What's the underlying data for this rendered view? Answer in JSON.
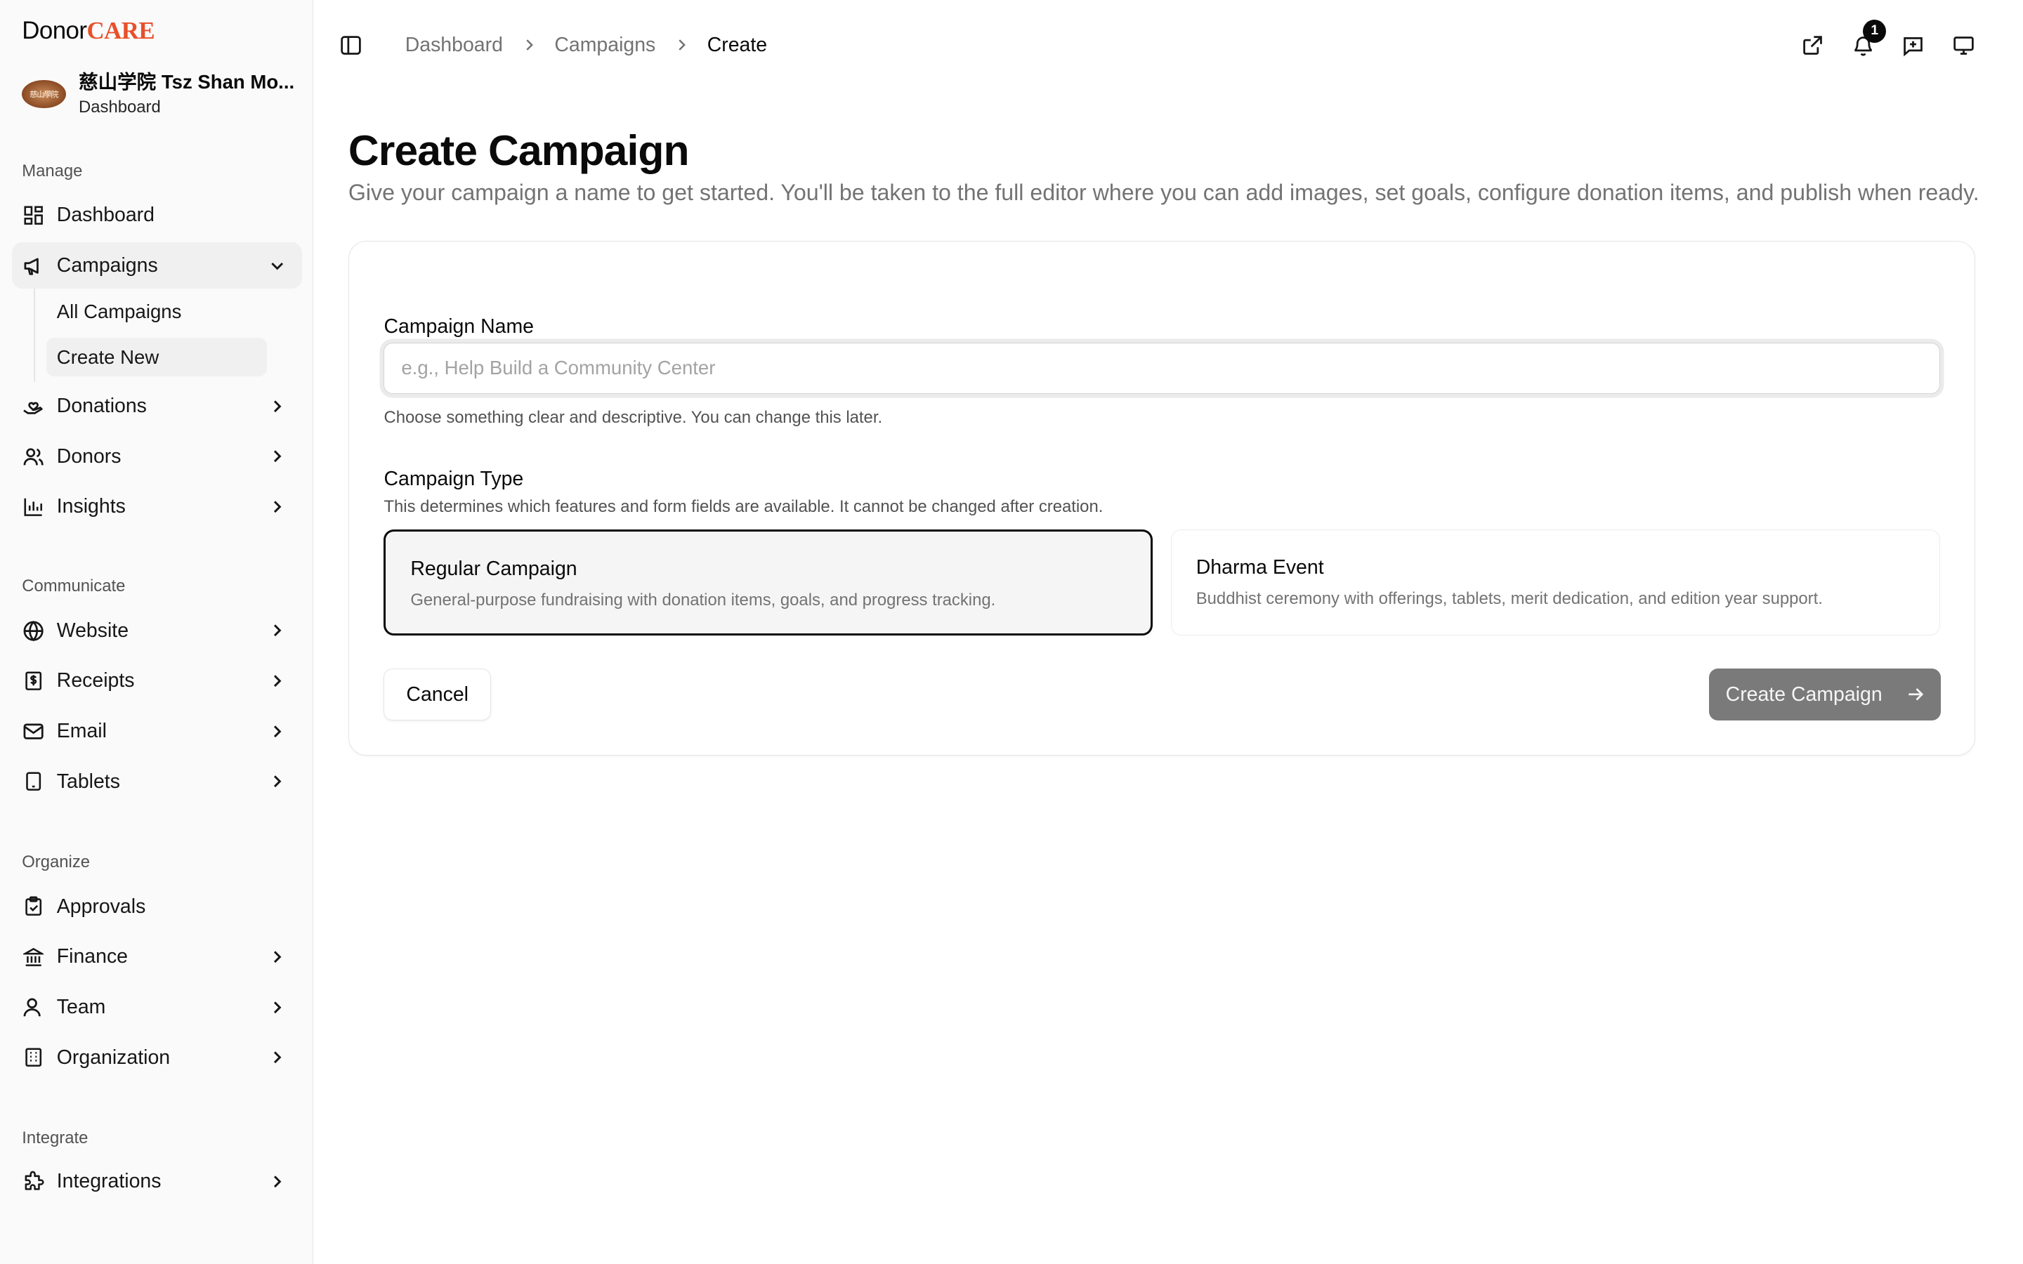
{
  "brand": {
    "part1": "Donor",
    "part2": "CARE"
  },
  "org": {
    "logo_text": "慈山學院",
    "name": "慈山学院 Tsz Shan Mo...",
    "subtitle": "Dashboard"
  },
  "sidebar": {
    "sections": {
      "manage": "Manage",
      "communicate": "Communicate",
      "organize": "Organize",
      "integrate": "Integrate"
    },
    "items": {
      "dashboard": "Dashboard",
      "campaigns": "Campaigns",
      "all_campaigns": "All Campaigns",
      "create_new": "Create New",
      "donations": "Donations",
      "donors": "Donors",
      "insights": "Insights",
      "website": "Website",
      "receipts": "Receipts",
      "email": "Email",
      "tablets": "Tablets",
      "approvals": "Approvals",
      "finance": "Finance",
      "team": "Team",
      "organization": "Organization",
      "integrations": "Integrations"
    }
  },
  "breadcrumb": [
    "Dashboard",
    "Campaigns",
    "Create"
  ],
  "header": {
    "notification_count": "1"
  },
  "page": {
    "title": "Create Campaign",
    "description": "Give your campaign a name to get started. You'll be taken to the full editor where you can add images, set goals, configure donation items, and publish when ready."
  },
  "form": {
    "name_label": "Campaign Name",
    "name_placeholder": "e.g., Help Build a Community Center",
    "name_value": "",
    "name_help": "Choose something clear and descriptive. You can change this later.",
    "type_label": "Campaign Type",
    "type_help": "This determines which features and form fields are available. It cannot be changed after creation.",
    "types": [
      {
        "title": "Regular Campaign",
        "desc": "General-purpose fundraising with donation items, goals, and progress tracking.",
        "selected": true
      },
      {
        "title": "Dharma Event",
        "desc": "Buddhist ceremony with offerings, tablets, merit dedication, and edition year support.",
        "selected": false
      }
    ],
    "cancel_label": "Cancel",
    "submit_label": "Create Campaign"
  },
  "colors": {
    "brand_accent": "#e8502a",
    "primary_disabled": "#7a7a7a",
    "text": "#0a0a0a",
    "muted": "#737373"
  }
}
